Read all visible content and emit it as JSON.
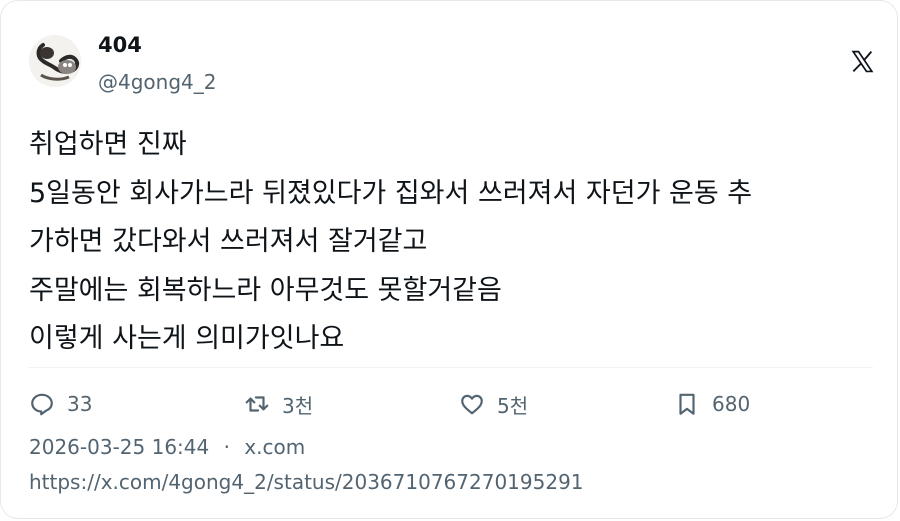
{
  "author": {
    "display_name": "404",
    "handle": "@4gong4_2"
  },
  "tweet": {
    "lines": [
      "취업하면 진짜",
      "5일동안 회사가느라 뒤졌있다가 집와서 쓰러져서 자던가 운동 추",
      "가하면 갔다와서 쓰러져서 잘거같고",
      "주말에는 회복하느라 아무것도 못할거같음",
      "이렇게 사는게 의미가잇나요"
    ]
  },
  "actions": {
    "replies": "33",
    "retweets": "3천",
    "likes": "5천",
    "bookmarks": "680"
  },
  "meta": {
    "date": "2026-03-25 16:44",
    "separator": "·",
    "source": "x.com",
    "url": "https://x.com/4gong4_2/status/2036710767270195291"
  },
  "icons": {
    "brand": "x-logo-icon",
    "reply": "comment-bubble-icon",
    "retweet": "retweet-icon",
    "like": "heart-icon",
    "bookmark": "bookmark-icon"
  },
  "colors": {
    "text_primary": "#0f1419",
    "text_secondary": "#536471",
    "border": "#e6e9ec"
  }
}
